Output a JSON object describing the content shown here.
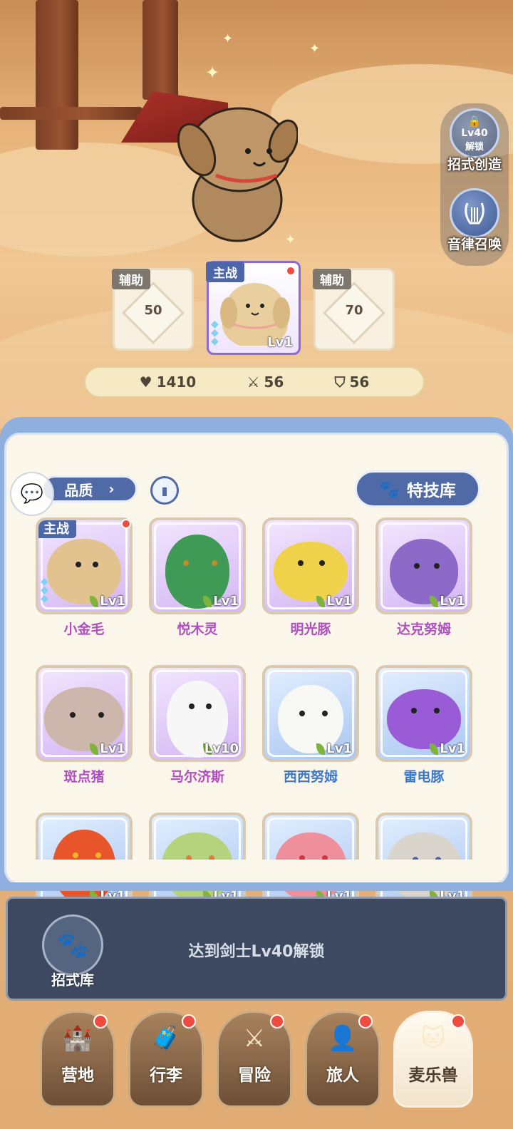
{
  "side_buttons": {
    "move_create": {
      "lock_level": "Lv40",
      "lock_text": "解锁",
      "label": "招式创造"
    },
    "rhythm_summon": {
      "label": "音律召唤"
    }
  },
  "team": {
    "left": {
      "tag": "辅助",
      "unlock_level": "50"
    },
    "main": {
      "tag": "主战",
      "level": "Lv1"
    },
    "right": {
      "tag": "辅助",
      "unlock_level": "70"
    }
  },
  "stats": {
    "hp": "1410",
    "attack": "56",
    "defense": "56"
  },
  "toolbar": {
    "filter_label": "品质",
    "skills_label": "特技库"
  },
  "pets": [
    {
      "name": "小金毛",
      "level": "Lv1",
      "rarity": "purple",
      "main": "主战",
      "color": "#e2c28e"
    },
    {
      "name": "悦木灵",
      "level": "Lv1",
      "rarity": "purple",
      "color": "#3f9a55"
    },
    {
      "name": "明光豚",
      "level": "Lv1",
      "rarity": "purple",
      "color": "#f0d24a"
    },
    {
      "name": "达克努姆",
      "level": "Lv1",
      "rarity": "purple",
      "color": "#8e6ac8"
    },
    {
      "name": "斑点猪",
      "level": "Lv1",
      "rarity": "purple",
      "color": "#cdb7ad"
    },
    {
      "name": "马尔济斯",
      "level": "Lv10",
      "rarity": "purple",
      "color": "#f7f7f7"
    },
    {
      "name": "西西努姆",
      "level": "Lv1",
      "rarity": "blue",
      "color": "#f8f8f4"
    },
    {
      "name": "雷电豚",
      "level": "Lv1",
      "rarity": "blue",
      "color": "#9a5bd6"
    },
    {
      "name": "",
      "level": "Lv1",
      "rarity": "blue",
      "color": "#e9552b"
    },
    {
      "name": "",
      "level": "Lv1",
      "rarity": "blue",
      "color": "#b5d27c"
    },
    {
      "name": "",
      "level": "Lv1",
      "rarity": "blue",
      "color": "#ef8f9c"
    },
    {
      "name": "",
      "level": "Lv1",
      "rarity": "blue",
      "color": "#d9d4cc"
    }
  ],
  "lock_bar": {
    "text": "达到剑士Lv40解锁",
    "library_label": "招式库"
  },
  "nav": [
    {
      "label": "营地",
      "icon": "castle-icon",
      "dot": true
    },
    {
      "label": "行李",
      "icon": "chest-icon",
      "dot": true
    },
    {
      "label": "冒险",
      "icon": "swords-icon",
      "dot": true
    },
    {
      "label": "旅人",
      "icon": "avatar-icon",
      "dot": true
    },
    {
      "label": "麦乐兽",
      "icon": "pet-icon",
      "dot": true,
      "active": true
    }
  ]
}
